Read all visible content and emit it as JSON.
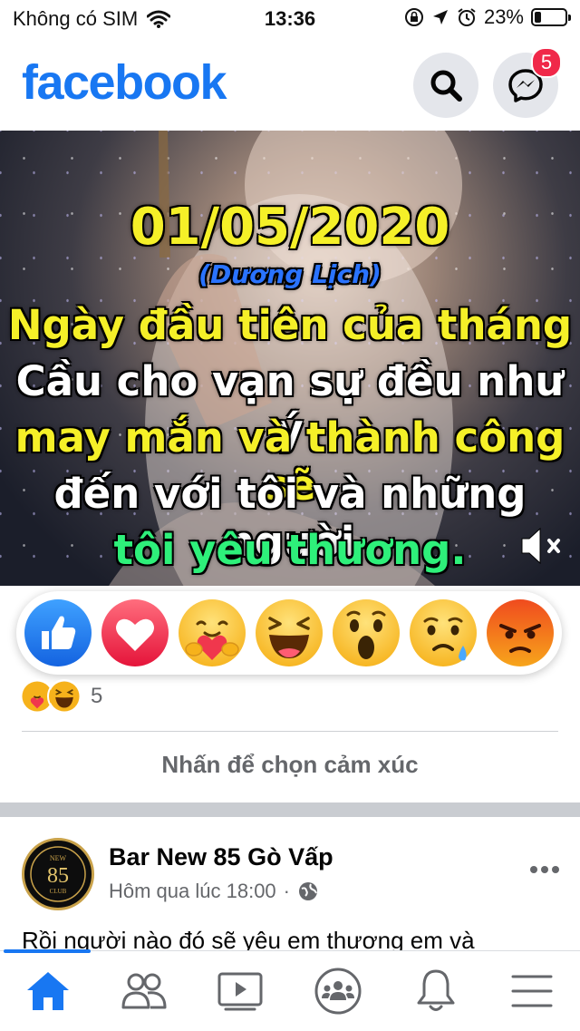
{
  "status_bar": {
    "carrier": "Không có SIM",
    "time": "13:36",
    "battery": "23%",
    "battery_level": 0.23
  },
  "header": {
    "logo": "facebook",
    "messenger_badge": "5"
  },
  "post_image": {
    "lines": [
      {
        "text": "01/05/2020",
        "color": "#f5f028"
      },
      {
        "text": "(Dương Lịch)",
        "color": "#2a73ff"
      },
      {
        "text": "Ngày đầu tiên của tháng",
        "color": "#f5f028"
      },
      {
        "text": "Cầu cho vạn sự đều như ý",
        "color": "#ffffff"
      },
      {
        "text": "may mắn và thành công sẽ",
        "color": "#f5f028"
      },
      {
        "text": "đến với tôi và những người",
        "color": "#ffffff"
      },
      {
        "text": "tôi yêu thương.",
        "color": "#2ef07a"
      }
    ]
  },
  "reactions": [
    "like",
    "love",
    "care",
    "haha",
    "wow",
    "sad",
    "angry"
  ],
  "reaction_summary": {
    "count": "5",
    "icons": [
      "care",
      "haha"
    ]
  },
  "tap_to_react": "Nhấn để chọn cảm xúc",
  "next_post": {
    "page_name": "Bar New 85 Gò Vấp",
    "time": "Hôm qua lúc 18:00",
    "separator": "·",
    "avatar_text_top": "NEW",
    "avatar_text_mid": "85",
    "avatar_text_bottom": "CLUB",
    "text": "Rồi người nào đó sẽ yêu em thương em và"
  },
  "tabs": [
    "home-icon",
    "friends-icon",
    "watch-icon",
    "groups-icon",
    "notifications-icon",
    "menu-icon"
  ],
  "colors": {
    "brand": "#1877f2",
    "badge": "#f02849"
  }
}
